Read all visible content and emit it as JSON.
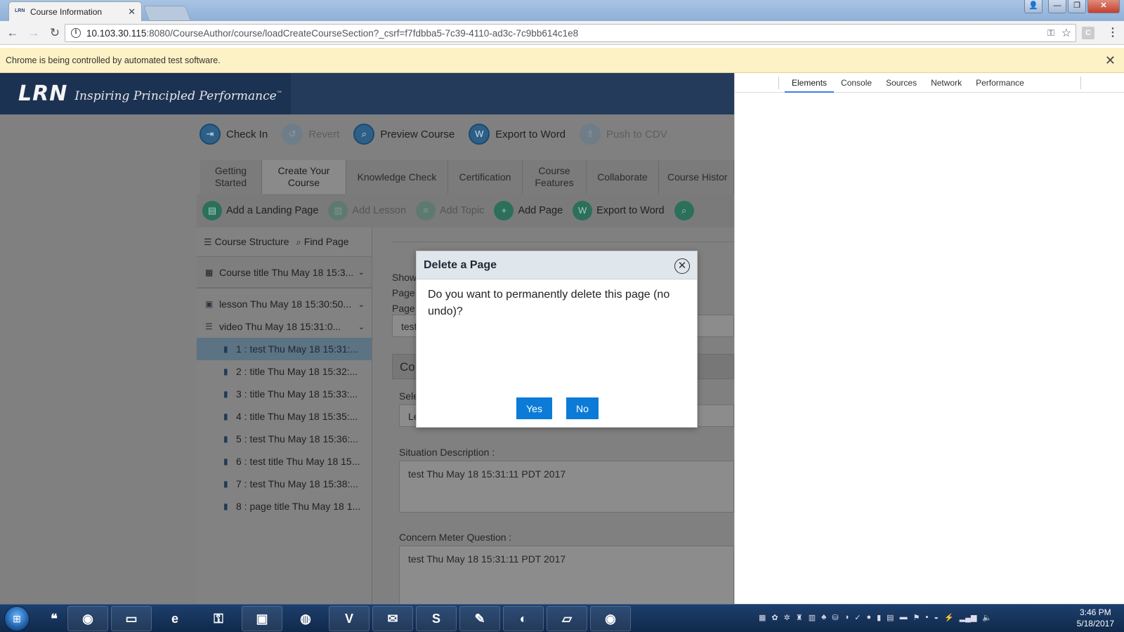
{
  "browser": {
    "tab_title": "Course Information",
    "favicon_text": "LRN",
    "url_host": "10.103.30.115",
    "url_path": ":8080/CourseAuthor/course/loadCreateCourseSection?_csrf=f7fdbba5-7c39-4110-ad3c-7c9bb614c1e8",
    "infobar_text": "Chrome is being controlled by automated test software."
  },
  "app": {
    "logo": "LRN",
    "tagline": "Inspiring Principled Performance",
    "tagline_tm": "™",
    "actions": [
      {
        "label": "Check In",
        "icon": "check-in-icon"
      },
      {
        "label": "Revert",
        "icon": "revert-icon"
      },
      {
        "label": "Preview Course",
        "icon": "preview-icon"
      },
      {
        "label": "Export to Word",
        "icon": "word-icon"
      },
      {
        "label": "Push to CDV",
        "icon": "push-icon"
      }
    ],
    "tabs": [
      {
        "label": "Getting Started"
      },
      {
        "label": "Create Your Course"
      },
      {
        "label": "Knowledge Check"
      },
      {
        "label": "Certification"
      },
      {
        "label": "Course Features"
      },
      {
        "label": "Collaborate"
      },
      {
        "label": "Course Histor"
      }
    ],
    "sub_actions": [
      {
        "label": "Add a Landing Page"
      },
      {
        "label": "Add Lesson"
      },
      {
        "label": "Add Topic"
      },
      {
        "label": "Add Page"
      },
      {
        "label": "Export to Word"
      }
    ],
    "left_panel": {
      "course_structure": "Course Structure",
      "find_page": "Find Page",
      "course_title": "Course title Thu May 18 15:3...",
      "lesson": "lesson Thu May 18 15:30:50...",
      "topic": "video Thu May 18 15:31:0...",
      "pages": [
        "1 : test Thu May 18 15:31:...",
        "2 : title Thu May 18 15:32:...",
        "3 : title Thu May 18 15:33:...",
        "4 : title Thu May 18 15:35:...",
        "5 : test Thu May 18 15:36:...",
        "6 : test title Thu May 18 15...",
        "7 : test Thu May 18 15:38:...",
        "8 : page title Thu May 18 1..."
      ]
    },
    "right_panel": {
      "show_label": "Show",
      "page_label_1": "Page",
      "page_label_2": "Page",
      "page_value": "test",
      "section_title": "Co",
      "select_label": "Sele",
      "select_value": "Le",
      "situation_label": "Situation Description :",
      "situation_value": "test Thu May 18 15:31:11 PDT 2017",
      "concern_label": "Concern Meter Question :",
      "concern_value": "test Thu May 18 15:31:11 PDT 2017"
    }
  },
  "modal": {
    "title": "Delete a Page",
    "message": "Do you want to permanently delete this page (no undo)?",
    "yes": "Yes",
    "no": "No"
  },
  "devtools": {
    "tabs": [
      "Elements",
      "Console",
      "Sources",
      "Network",
      "Performance"
    ],
    "active_tab": "Elements"
  },
  "taskbar": {
    "time": "3:46 PM",
    "date": "5/18/2017"
  }
}
